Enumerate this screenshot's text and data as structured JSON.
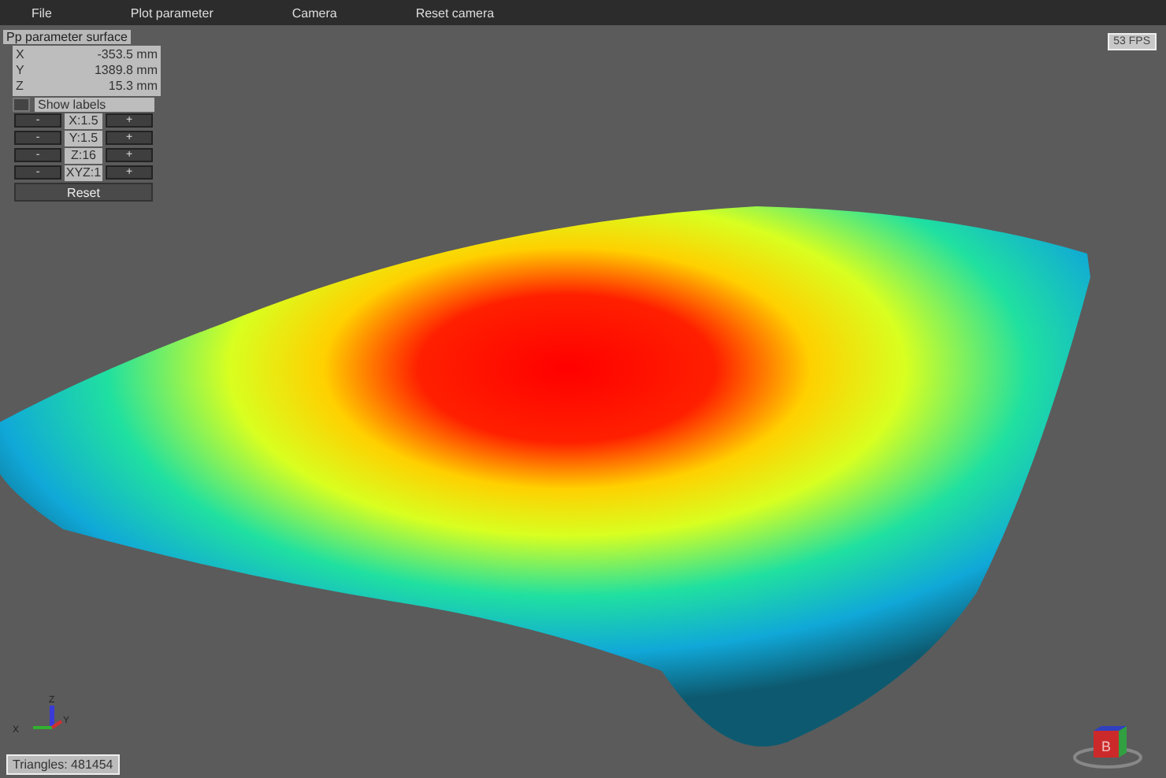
{
  "menu": [
    "File",
    "Plot parameter",
    "Camera",
    "Reset camera"
  ],
  "panel": {
    "title": "Pp parameter surface",
    "coords": [
      {
        "axis": "X",
        "value": "-353.5 mm"
      },
      {
        "axis": "Y",
        "value": "1389.8 mm"
      },
      {
        "axis": "Z",
        "value": "15.3 mm"
      }
    ],
    "show_labels": {
      "label": "Show labels",
      "checked": false
    },
    "scales": [
      {
        "minus": "-",
        "label": "X:1.5",
        "plus": "+"
      },
      {
        "minus": "-",
        "label": "Y:1.5",
        "plus": "+"
      },
      {
        "minus": "-",
        "label": "Z:16",
        "plus": "+"
      },
      {
        "minus": "-",
        "label": "XYZ:1",
        "plus": "+"
      }
    ],
    "reset": "Reset"
  },
  "fps": "53 FPS",
  "triad": {
    "x": "X",
    "y": "Y",
    "z": "Z"
  },
  "view_cube": "B",
  "triangles": "Triangles: 481454"
}
